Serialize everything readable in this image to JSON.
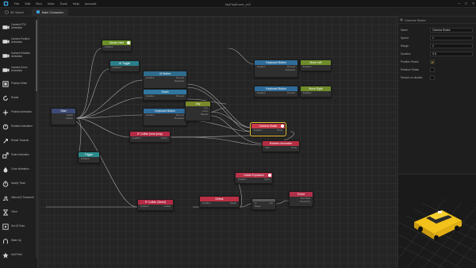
{
  "titlebar": {
    "menu": [
      "File",
      "Edit",
      "Run",
      "View",
      "Tools",
      "Help",
      "Account"
    ],
    "window_title": "MyFirstEvent_v02"
  },
  "tabbar": {
    "tool_label": "3D World",
    "tab_label": "Main Character"
  },
  "toolbox": {
    "items": [
      {
        "label": "Camera FOV Animation",
        "icon": "camera-icon"
      },
      {
        "label": "Camera Position Animation",
        "icon": "camera-icon"
      },
      {
        "label": "Camera Rotation Animation",
        "icon": "camera-icon"
      },
      {
        "label": "Camera Zoom Animation",
        "icon": "camera-icon"
      },
      {
        "label": "Position Slider",
        "icon": "position-slider-icon"
      },
      {
        "label": "Rotate",
        "icon": "rotate-icon"
      },
      {
        "label": "Position Animation",
        "icon": "position-animation-icon"
      },
      {
        "label": "Rotation Animation",
        "icon": "rotation-animation-icon"
      },
      {
        "label": "Rotate Towards",
        "icon": "rotate-towards-icon"
      },
      {
        "label": "Scale Animation",
        "icon": "scale-animation-icon"
      },
      {
        "label": "Color Animation",
        "icon": "color-animation-icon"
      },
      {
        "label": "Modify Timer",
        "icon": "timer-icon"
      },
      {
        "label": "Interval & Threshold",
        "icon": "interval-icon"
      },
      {
        "label": "Timer",
        "icon": "timer-icon"
      },
      {
        "label": "Set Of Point",
        "icon": "set-of-point-icon"
      },
      {
        "label": "Wake Up",
        "icon": "wake-up-icon"
      },
      {
        "label": "Add Point",
        "icon": "add-point-icon"
      },
      {
        "label": "Add Coin",
        "icon": "add-coin-icon"
      },
      {
        "label": "Restart",
        "icon": "restart-icon"
      },
      {
        "label": "Level",
        "icon": "level-icon"
      }
    ]
  },
  "nodes": {
    "start": {
      "title": "Start",
      "rows": [
        [
          "",
          "Awake"
        ],
        [
          "",
          "Update"
        ]
      ]
    },
    "mouse_hold": {
      "title": "Mouse Hold",
      "rows": [
        [
          "Enabled",
          ""
        ]
      ]
    },
    "ui_toggle": {
      "title": "UI Toggle",
      "rows": [
        [
          "Enabled",
          ""
        ]
      ]
    },
    "ui_button": {
      "title": "UI Button",
      "rows": [
        [
          "Enabled",
          "Pressed"
        ],
        [
          "",
          "Released"
        ]
      ]
    },
    "touch": {
      "title": "Touch",
      "rows": [
        [
          "Enabled",
          "Pressed"
        ]
      ]
    },
    "keyboard_button_1": {
      "title": "Keyboard Button",
      "rows": [
        [
          "Enabled",
          "Pressed"
        ],
        [
          "",
          "Released"
        ]
      ]
    },
    "any": {
      "title": "Any",
      "rows": [
        [
          "",
          "Any"
        ],
        [
          "",
          "Once"
        ],
        [
          "",
          "Repeat"
        ]
      ]
    },
    "keyboard_button_2": {
      "title": "Keyboard Button",
      "rows": [
        [
          "Enabled",
          "Pressed"
        ],
        [
          "",
          "Released"
        ]
      ]
    },
    "move_left": {
      "title": "Move Left",
      "rows": [
        [
          "Enabled",
          ""
        ]
      ]
    },
    "keyboard_button_3": {
      "title": "Keyboard Button",
      "rows": [
        [
          "Enabled",
          "Pressed"
        ]
      ]
    },
    "move_right": {
      "title": "Move Right",
      "rows": [
        [
          "Enabled",
          ""
        ]
      ]
    },
    "camera_shake": {
      "title": "Camera Shake",
      "rows": [
        [
          "Enabled",
          "Done"
        ]
      ]
    },
    "rotation_animation": {
      "title": "Rotation Animation",
      "rows": [
        [
          "Start",
          "Done"
        ]
      ]
    },
    "if_collide_near": {
      "title": "IF Collide (near jump)",
      "rows": [
        [
          "Enabled",
          "Collide"
        ]
      ]
    },
    "trigger": {
      "title": "Trigger",
      "rows": [
        [
          "Enabled",
          ""
        ]
      ]
    },
    "delete_explosion": {
      "title": "Delete Explosion",
      "rows": [
        [
          "Enabled",
          "Done"
        ]
      ]
    },
    "if_collide_street": {
      "title": "IF Collide (Street)",
      "rows": [
        [
          "Enabled",
          "Collide"
        ]
      ]
    },
    "defeat": {
      "title": "Defeat",
      "rows": [
        [
          "Enabled",
          "Defeat"
        ]
      ]
    },
    "gate": {
      "title": "",
      "rows": [
        [
          "In",
          "Out"
        ],
        [
          "Reset",
          ""
        ]
      ]
    },
    "event": {
      "title": "Event",
      "rows": [
        [
          "",
          "Next Data"
        ],
        [
          "",
          "Next Entry"
        ]
      ]
    }
  },
  "colors": {
    "start": "#3d4a77",
    "mouse_hold": "#6a8f28",
    "ui_toggle": "#2b7f8a",
    "ui_button": "#2f6c8d",
    "touch": "#2f77a0",
    "keyboard": "#2f6c9a",
    "any": "#7a8a28",
    "move": "#6f8c2a",
    "camera_shake": "#c93a4a",
    "rotation_animation": "#b52d43",
    "if_collide": "#b22a44",
    "trigger": "#2b8a8a",
    "delete_explosion": "#b8324a",
    "defeat": "#b92f44",
    "gate": "#5a5a5a",
    "event": "#b0304a",
    "selection": "#e8c23a"
  },
  "properties": {
    "title": "Camera Shake",
    "rows": [
      {
        "key": "Name",
        "value": "Camera Shake",
        "type": "text"
      },
      {
        "key": "Speed",
        "value": "1",
        "type": "text"
      },
      {
        "key": "Range",
        "value": "2",
        "type": "text"
      },
      {
        "key": "Duration",
        "value": "0.5",
        "type": "text"
      },
      {
        "key": "Position Shake",
        "value": true,
        "type": "checkbox"
      },
      {
        "key": "Rotation Shake",
        "value": false,
        "type": "checkbox"
      },
      {
        "key": "Restart on disable",
        "value": false,
        "type": "checkbox"
      }
    ]
  }
}
